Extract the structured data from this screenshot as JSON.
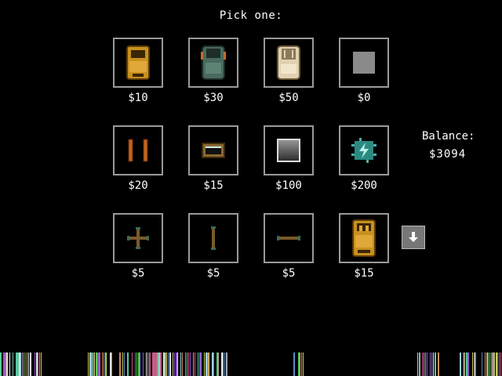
{
  "header": {
    "title": "Pick one:"
  },
  "items": [
    {
      "price": "$10",
      "icon": "gold-car-icon"
    },
    {
      "price": "$30",
      "icon": "teal-car-icon"
    },
    {
      "price": "$50",
      "icon": "cream-car-icon"
    },
    {
      "price": "$0",
      "icon": "gray-square-icon"
    },
    {
      "price": "$20",
      "icon": "bumper-pair-icon"
    },
    {
      "price": "$15",
      "icon": "window-frame-icon"
    },
    {
      "price": "$100",
      "icon": "metal-block-icon"
    },
    {
      "price": "$200",
      "icon": "lightning-chip-icon"
    },
    {
      "price": "$5",
      "icon": "cross-pipe-icon"
    },
    {
      "price": "$5",
      "icon": "vertical-rod-icon"
    },
    {
      "price": "$5",
      "icon": "horizontal-rod-icon"
    },
    {
      "price": "$15",
      "icon": "gold-car-rear-icon"
    }
  ],
  "balance": {
    "label": "Balance:",
    "value": "$3094"
  },
  "scroll": {
    "icon": "arrow-down-icon"
  },
  "colors": {
    "frame": "#9a9a9a",
    "button": "#777777",
    "background": "#000000"
  }
}
